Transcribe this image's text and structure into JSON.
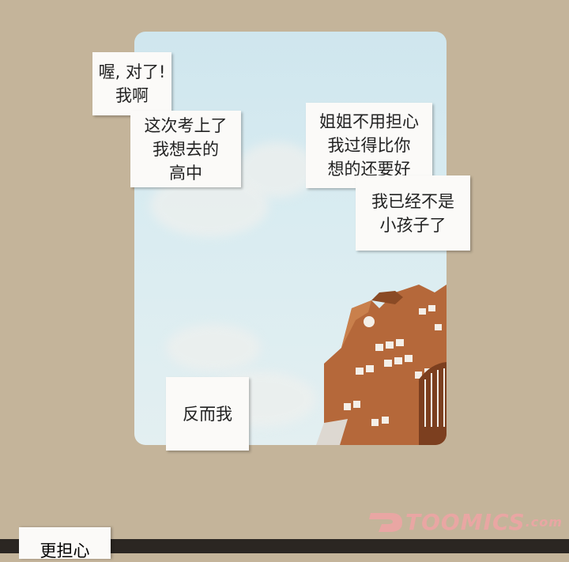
{
  "bubbles": {
    "b1": [
      "喔, 对了!",
      "我啊"
    ],
    "b2": [
      "这次考上了",
      "我想去的",
      "高中"
    ],
    "b3": [
      "姐姐不用担心",
      "我过得比你",
      "想的还要好"
    ],
    "b4": [
      "我已经不是",
      "小孩子了"
    ],
    "b5": [
      "反而我"
    ],
    "b6": [
      "更担心"
    ]
  },
  "logo": {
    "main": "TOOMICS",
    "suffix": ".com"
  },
  "colors": {
    "background": "#c4b49a",
    "sky": "#d9ecf1",
    "building": "#b5683a",
    "logo": "#e9a6a3"
  }
}
